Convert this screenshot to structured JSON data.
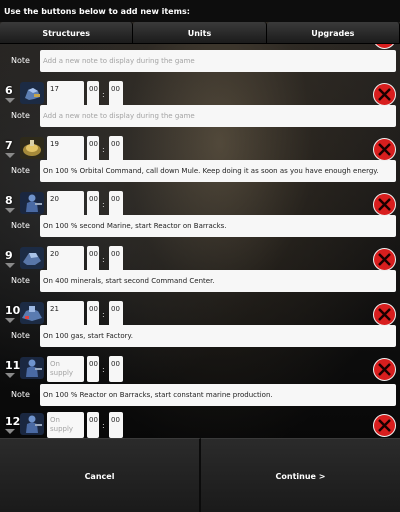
{
  "header": {
    "text": "Use the buttons below to add new items:"
  },
  "tabs": [
    {
      "label": "Structures"
    },
    {
      "label": "Units"
    },
    {
      "label": "Upgrades"
    }
  ],
  "colors": {
    "delete_red": "#d81e1e",
    "background_dark": "#0d0d0d",
    "field_bg": "#f7f7f7",
    "placeholder": "#a3a3a3"
  },
  "note_label": "Note",
  "time_separator": ":",
  "notes": [
    {
      "text": "Add a new note to display during the game",
      "placeholder": true
    },
    {
      "text": "Add a new note to display during the game",
      "placeholder": true
    },
    {
      "text": "On 100 % Orbital Command, call down Mule. Keep doing it as soon as you have enough energy.",
      "placeholder": false
    },
    {
      "text": "On 100 % second Marine, start Reactor on Barracks.",
      "placeholder": false
    },
    {
      "text": "On 400 minerals, start second Command Center.",
      "placeholder": false
    },
    {
      "text": "On 100 gas, start Factory.",
      "placeholder": false
    },
    {
      "text": "On 100 % Reactor on Barracks, start constant marine production.",
      "placeholder": false
    }
  ],
  "steps": [
    {
      "number": "6",
      "icon": "scv-icon",
      "supply": "17",
      "supply_placeholder": false,
      "min": "00",
      "sec": "00"
    },
    {
      "number": "7",
      "icon": "orbital-command-icon",
      "supply": "19",
      "supply_placeholder": false,
      "min": "00",
      "sec": "00"
    },
    {
      "number": "8",
      "icon": "marine-icon",
      "supply": "20",
      "supply_placeholder": false,
      "min": "00",
      "sec": "00"
    },
    {
      "number": "9",
      "icon": "reactor-icon",
      "supply": "20",
      "supply_placeholder": false,
      "min": "00",
      "sec": "00"
    },
    {
      "number": "10",
      "icon": "command-center-icon",
      "supply": "21",
      "supply_placeholder": false,
      "min": "00",
      "sec": "00"
    },
    {
      "number": "11",
      "icon": "marine-icon",
      "supply": "On supply",
      "supply_placeholder": true,
      "min": "00",
      "sec": "00"
    },
    {
      "number": "12",
      "icon": "marine-icon",
      "supply": "On supply",
      "supply_placeholder": true,
      "min": "00",
      "sec": "00"
    }
  ],
  "footer": {
    "cancel_label": "Cancel",
    "continue_label": "Continue >"
  }
}
